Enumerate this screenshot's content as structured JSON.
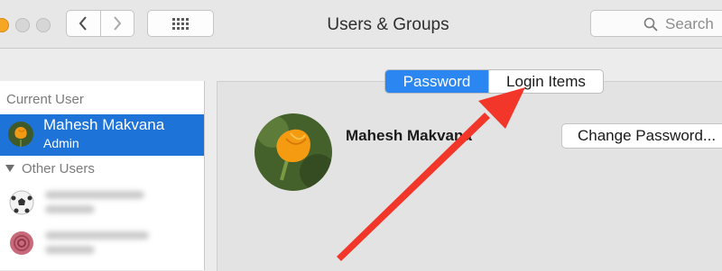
{
  "window": {
    "title": "Users & Groups",
    "search_placeholder": "Search"
  },
  "toolbar": {
    "back_icon": "chevron-left-icon",
    "forward_icon": "chevron-right-icon",
    "show_all_icon": "grid-icon"
  },
  "sidebar": {
    "current_user_label": "Current User",
    "current_user": {
      "name": "Mahesh Makvana",
      "role": "Admin"
    },
    "other_users_label": "Other Users"
  },
  "main": {
    "tabs": [
      {
        "label": "Password",
        "active": true
      },
      {
        "label": "Login Items",
        "active": false
      }
    ],
    "profile_name": "Mahesh Makvana",
    "change_password_label": "Change Password..."
  },
  "colors": {
    "selection_blue": "#1d73d8",
    "segment_active": "#2b86f1",
    "annotation_arrow": "#f2362a"
  }
}
